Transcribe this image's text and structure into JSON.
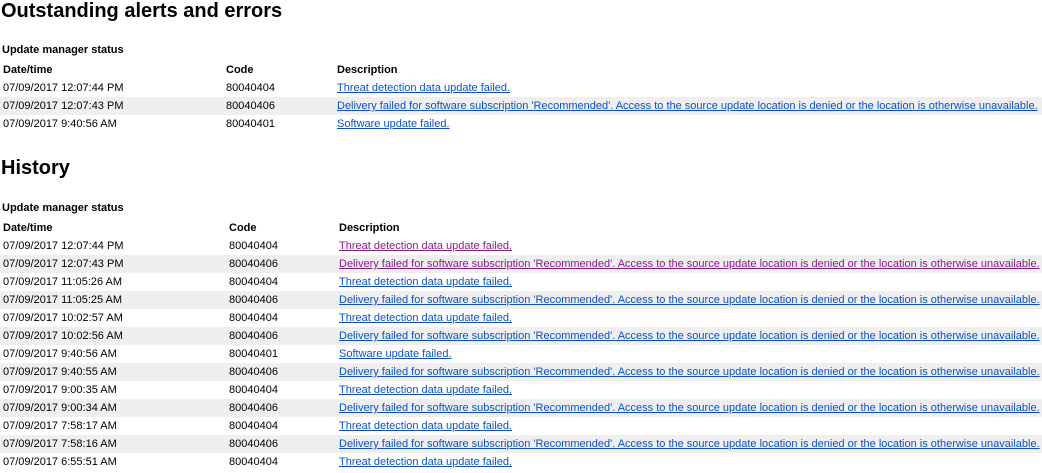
{
  "outstanding": {
    "title": "Outstanding alerts and errors",
    "subtitle": "Update manager status",
    "columns": {
      "datetime": "Date/time",
      "code": "Code",
      "description": "Description"
    },
    "rows": [
      {
        "datetime": "07/09/2017 12:07:44 PM",
        "code": "80040404",
        "description": "Threat detection data update failed."
      },
      {
        "datetime": "07/09/2017 12:07:43 PM",
        "code": "80040406",
        "description": "Delivery failed for software subscription 'Recommended'. Access to the source update location is denied or the location is otherwise unavailable."
      },
      {
        "datetime": "07/09/2017 9:40:56 AM",
        "code": "80040401",
        "description": "Software update failed."
      }
    ]
  },
  "history": {
    "title": "History",
    "subtitle": "Update manager status",
    "columns": {
      "datetime": "Date/time",
      "code": "Code",
      "description": "Description"
    },
    "rows": [
      {
        "datetime": "07/09/2017 12:07:44 PM",
        "code": "80040404",
        "description": "Threat detection data update failed.",
        "visited": true
      },
      {
        "datetime": "07/09/2017 12:07:43 PM",
        "code": "80040406",
        "description": "Delivery failed for software subscription 'Recommended'. Access to the source update location is denied or the location is otherwise unavailable.",
        "visited": true
      },
      {
        "datetime": "07/09/2017 11:05:26 AM",
        "code": "80040404",
        "description": "Threat detection data update failed."
      },
      {
        "datetime": "07/09/2017 11:05:25 AM",
        "code": "80040406",
        "description": "Delivery failed for software subscription 'Recommended'. Access to the source update location is denied or the location is otherwise unavailable."
      },
      {
        "datetime": "07/09/2017 10:02:57 AM",
        "code": "80040404",
        "description": "Threat detection data update failed."
      },
      {
        "datetime": "07/09/2017 10:02:56 AM",
        "code": "80040406",
        "description": "Delivery failed for software subscription 'Recommended'. Access to the source update location is denied or the location is otherwise unavailable."
      },
      {
        "datetime": "07/09/2017 9:40:56 AM",
        "code": "80040401",
        "description": "Software update failed."
      },
      {
        "datetime": "07/09/2017 9:40:55 AM",
        "code": "80040406",
        "description": "Delivery failed for software subscription 'Recommended'. Access to the source update location is denied or the location is otherwise unavailable."
      },
      {
        "datetime": "07/09/2017 9:00:35 AM",
        "code": "80040404",
        "description": "Threat detection data update failed."
      },
      {
        "datetime": "07/09/2017 9:00:34 AM",
        "code": "80040406",
        "description": "Delivery failed for software subscription 'Recommended'. Access to the source update location is denied or the location is otherwise unavailable."
      },
      {
        "datetime": "07/09/2017 7:58:17 AM",
        "code": "80040404",
        "description": "Threat detection data update failed."
      },
      {
        "datetime": "07/09/2017 7:58:16 AM",
        "code": "80040406",
        "description": "Delivery failed for software subscription 'Recommended'. Access to the source update location is denied or the location is otherwise unavailable."
      },
      {
        "datetime": "07/09/2017 6:55:51 AM",
        "code": "80040404",
        "description": "Threat detection data update failed."
      }
    ]
  },
  "colors": {
    "link": "#0b4fd1",
    "visited_link": "#8b1a8b",
    "alt_row": "#efefef"
  }
}
